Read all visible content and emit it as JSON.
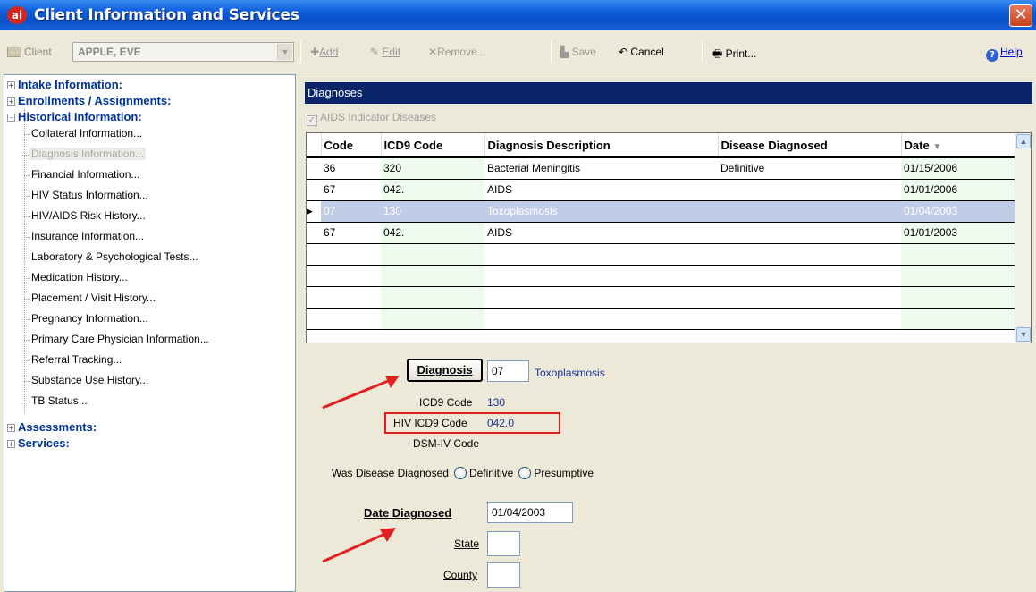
{
  "window": {
    "logo": "ai",
    "title": "Client Information and Services",
    "close": "✕"
  },
  "toolbar": {
    "client_label": "Client",
    "client_value": "APPLE, EVE",
    "add": "Add",
    "edit": "Edit",
    "remove": "Remove...",
    "save": "Save",
    "cancel": "Cancel",
    "print": "Print...",
    "help": "Help"
  },
  "tree": {
    "sections": [
      {
        "label": "Intake Information:",
        "expanded": false
      },
      {
        "label": "Enrollments / Assignments:",
        "expanded": false
      },
      {
        "label": "Historical Information:",
        "expanded": true
      },
      {
        "label": "Assessments:",
        "expanded": false
      },
      {
        "label": "Services:",
        "expanded": false
      }
    ],
    "historical_children": [
      "Collateral Information...",
      "Diagnosis Information...",
      "Financial Information...",
      "HIV Status Information...",
      "HIV/AIDS Risk History...",
      "Insurance Information...",
      "Laboratory & Psychological Tests...",
      "Medication History...",
      "Placement / Visit History...",
      "Pregnancy Information...",
      "Primary Care Physician Information...",
      "Referral Tracking...",
      "Substance Use History...",
      "TB Status..."
    ],
    "selected_child": "Diagnosis Information..."
  },
  "diagnoses": {
    "header": "Diagnoses",
    "aids_indicator_label": "AIDS Indicator Diseases",
    "aids_indicator_checked": true,
    "columns": [
      "Code",
      "ICD9 Code",
      "Diagnosis Description",
      "Disease Diagnosed",
      "Date"
    ],
    "sort_indicator": "▼",
    "rows": [
      {
        "code": "36",
        "icd9": "320",
        "description": "Bacterial Meningitis",
        "diagnosed": "Definitive",
        "date": "01/15/2006",
        "selected": false
      },
      {
        "code": "67",
        "icd9": "042.",
        "description": "AIDS",
        "diagnosed": "",
        "date": "01/01/2006",
        "selected": false
      },
      {
        "code": "07",
        "icd9": "130",
        "description": "Toxoplasmosis",
        "diagnosed": "",
        "date": "01/04/2003",
        "selected": true
      },
      {
        "code": "67",
        "icd9": "042.",
        "description": "AIDS",
        "diagnosed": "",
        "date": "01/01/2003",
        "selected": false
      }
    ],
    "empty_rows": 4
  },
  "form": {
    "diagnosis_button": "Diagnosis",
    "diagnosis_code": "07",
    "diagnosis_name": "Toxoplasmosis",
    "icd9_label": "ICD9 Code",
    "icd9_value": "130",
    "hiv_icd9_label": "HIV ICD9 Code",
    "hiv_icd9_value": "042.0",
    "dsm_label": "DSM-IV Code",
    "dsm_value": "",
    "was_diagnosed_label": "Was Disease Diagnosed",
    "opt_definitive": "Definitive",
    "opt_presumptive": "Presumptive",
    "date_diagnosed_label": "Date Diagnosed",
    "date_diagnosed_value": "01/04/2003",
    "state_label": "State",
    "state_value": "",
    "county_label": "County",
    "county_value": ""
  },
  "colors": {
    "title_bar": "#0a50c8",
    "section_header": "#0a246a",
    "tree_heading": "#003399",
    "highlight_box": "#e02020",
    "selected_row": "#c0cde6",
    "grid_tint": "#eefaee"
  }
}
